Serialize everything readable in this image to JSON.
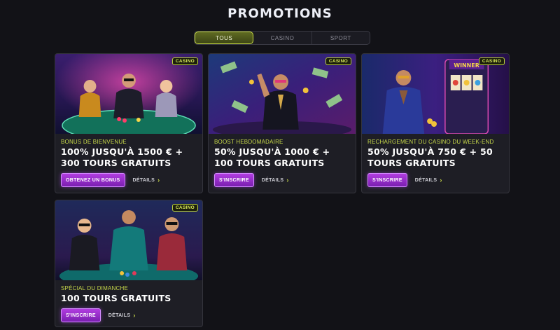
{
  "page": {
    "title": "PROMOTIONS"
  },
  "tabs": [
    {
      "label": "TOUS",
      "active": true
    },
    {
      "label": "CASINO",
      "active": false
    },
    {
      "label": "SPORT",
      "active": false
    }
  ],
  "promotions": [
    {
      "badge": "CASINO",
      "subtitle": "BONUS DE BIENVENUE",
      "headline": "100% JUSQU'À 1500 € + 300 TOURS GRATUITS",
      "cta_label": "OBTENEZ UN BONUS",
      "details_label": "DÉTAILS",
      "image_name": "poker-table-image"
    },
    {
      "badge": "CASINO",
      "subtitle": "BOOST HEBDOMADAIRE",
      "headline": "50% JUSQU'À 1000 € + 100 TOURS GRATUITS",
      "cta_label": "S'INSCRIRE",
      "details_label": "DÉTAILS",
      "image_name": "money-rain-image"
    },
    {
      "badge": "CASINO",
      "subtitle": "RECHARGEMENT DU CASINO DU WEEK-END",
      "headline": "50% JUSQU'À 750 € + 50 TOURS GRATUITS",
      "cta_label": "S'INSCRIRE",
      "details_label": "DÉTAILS",
      "image_name": "slot-machine-image",
      "image_text": "WINNER"
    },
    {
      "badge": "CASINO",
      "subtitle": "SPÉCIAL DU DIMANCHE",
      "headline": "100 TOURS GRATUITS",
      "cta_label": "S'INSCRIRE",
      "details_label": "DÉTAILS",
      "image_name": "sunday-poker-image"
    }
  ],
  "colors": {
    "background": "#121217",
    "accent_lime": "#c7d84a",
    "cta_purple": "#9a2fd0",
    "card": "#1e1e25"
  }
}
